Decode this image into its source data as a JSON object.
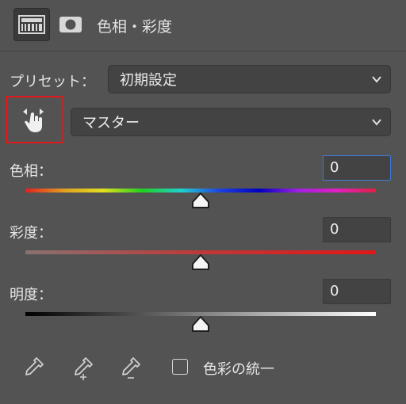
{
  "header": {
    "title": "色相・彩度",
    "icons": [
      "adjustment-layer-icon",
      "mask-icon"
    ]
  },
  "preset": {
    "label": "プリセット：",
    "value": "初期設定"
  },
  "channel": {
    "value": "マスター"
  },
  "sliders": [
    {
      "label": "色相：",
      "value": "0",
      "fraction": 0.5
    },
    {
      "label": "彩度：",
      "value": "0",
      "fraction": 0.5
    },
    {
      "label": "明度：",
      "value": "0",
      "fraction": 0.5
    }
  ],
  "footer": {
    "colorize_label": "色彩の統一",
    "colorize_checked": false
  },
  "colors": {
    "panel_bg": "#535353",
    "field_bg": "#434343",
    "focus_border": "#3f79d4",
    "highlight_border": "#e0191c"
  }
}
